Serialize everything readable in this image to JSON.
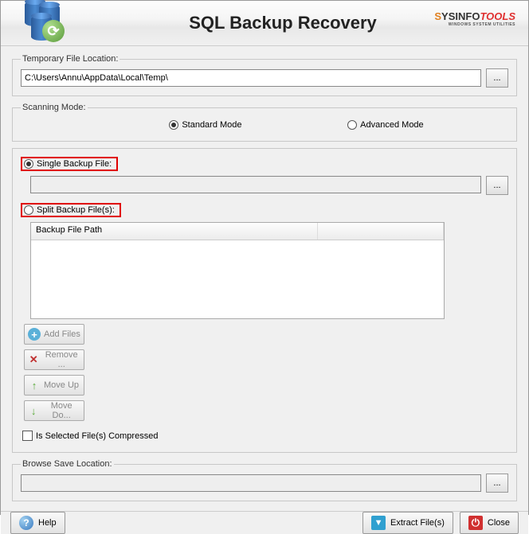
{
  "header": {
    "title": "SQL Backup Recovery",
    "brand": {
      "part1": "S",
      "part2": "YSINFO",
      "part3": "TOOLS",
      "sub": "WINDOWS SYSTEM UTILITIES"
    }
  },
  "temp_location": {
    "legend": "Temporary File Location:",
    "value": "C:\\Users\\Annu\\AppData\\Local\\Temp\\",
    "browse": "..."
  },
  "scanning_mode": {
    "legend": "Scanning Mode:",
    "standard": "Standard Mode",
    "advanced": "Advanced Mode",
    "selected": "standard"
  },
  "backup": {
    "single_label": "Single Backup File:",
    "single_selected": true,
    "single_value": "",
    "single_browse": "...",
    "split_label": "Split Backup File(s):",
    "split_selected": false,
    "table_header": "Backup File Path",
    "buttons": {
      "add": "Add Files",
      "remove": "Remove ...",
      "moveup": "Move Up",
      "movedown": "Move Do..."
    },
    "compressed_label": "Is Selected File(s) Compressed"
  },
  "save_location": {
    "legend": "Browse Save Location:",
    "value": "",
    "browse": "..."
  },
  "footer": {
    "help": "Help",
    "extract": "Extract File(s)",
    "close": "Close"
  }
}
